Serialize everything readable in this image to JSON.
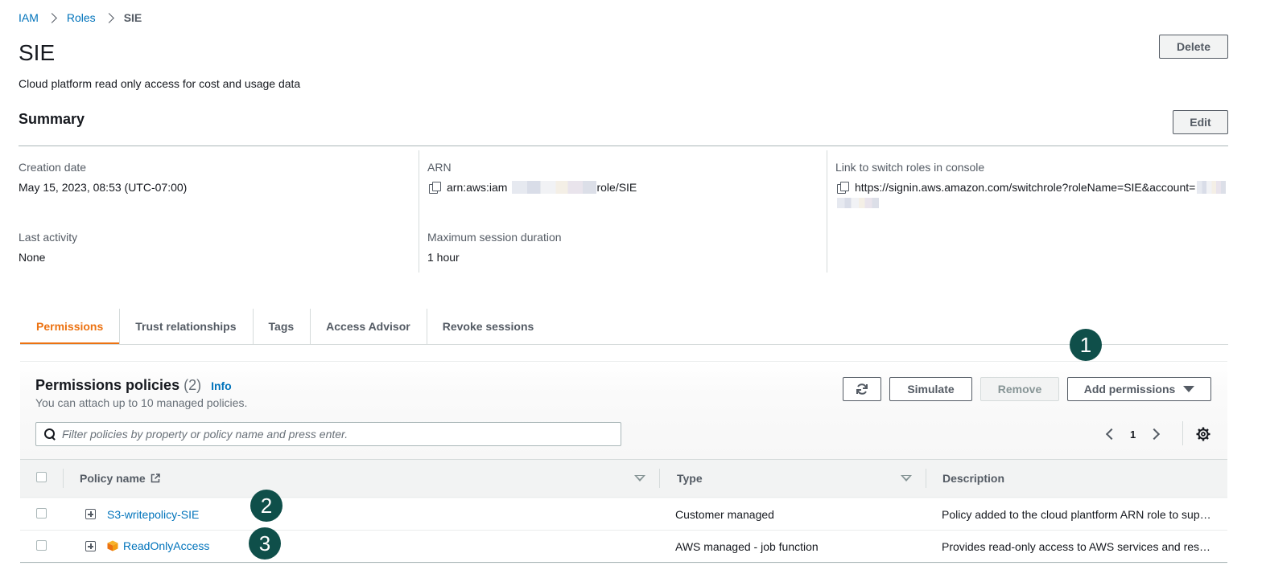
{
  "breadcrumb": {
    "iam": "IAM",
    "roles": "Roles",
    "current": "SIE"
  },
  "header": {
    "title": "SIE",
    "description": "Cloud platform read only access for cost and usage data",
    "delete_label": "Delete"
  },
  "summary": {
    "title": "Summary",
    "edit_label": "Edit",
    "creation_date_label": "Creation date",
    "creation_date_value": "May 15, 2023, 08:53 (UTC-07:00)",
    "arn_label": "ARN",
    "arn_prefix": "arn:aws:iam",
    "arn_suffix": "role/SIE",
    "switch_label": "Link to switch roles in console",
    "switch_value": "https://signin.aws.amazon.com/switchrole?roleName=SIE&account=",
    "last_activity_label": "Last activity",
    "last_activity_value": "None",
    "max_session_label": "Maximum session duration",
    "max_session_value": "1 hour"
  },
  "tabs": [
    {
      "label": "Permissions"
    },
    {
      "label": "Trust relationships"
    },
    {
      "label": "Tags"
    },
    {
      "label": "Access Advisor"
    },
    {
      "label": "Revoke sessions"
    }
  ],
  "badges": [
    "1",
    "2",
    "3"
  ],
  "policies": {
    "title": "Permissions policies",
    "count": "(2)",
    "info": "Info",
    "subtitle": "You can attach up to 10 managed policies.",
    "simulate_label": "Simulate",
    "remove_label": "Remove",
    "add_label": "Add permissions",
    "search_placeholder": "Filter policies by property or policy name and press enter.",
    "page": "1",
    "columns": {
      "name": "Policy name",
      "type": "Type",
      "description": "Description"
    },
    "rows": [
      {
        "name": "S3-writepolicy-SIE",
        "type": "Customer managed",
        "description": "Policy added to the cloud plantform ARN role to sup…"
      },
      {
        "name": "ReadOnlyAccess",
        "type": "AWS managed - job function",
        "description": "Provides read-only access to AWS services and res…"
      }
    ]
  },
  "colors": {
    "link": "#0073bb",
    "accent": "#ec7211",
    "badge": "#0f4f4a"
  }
}
